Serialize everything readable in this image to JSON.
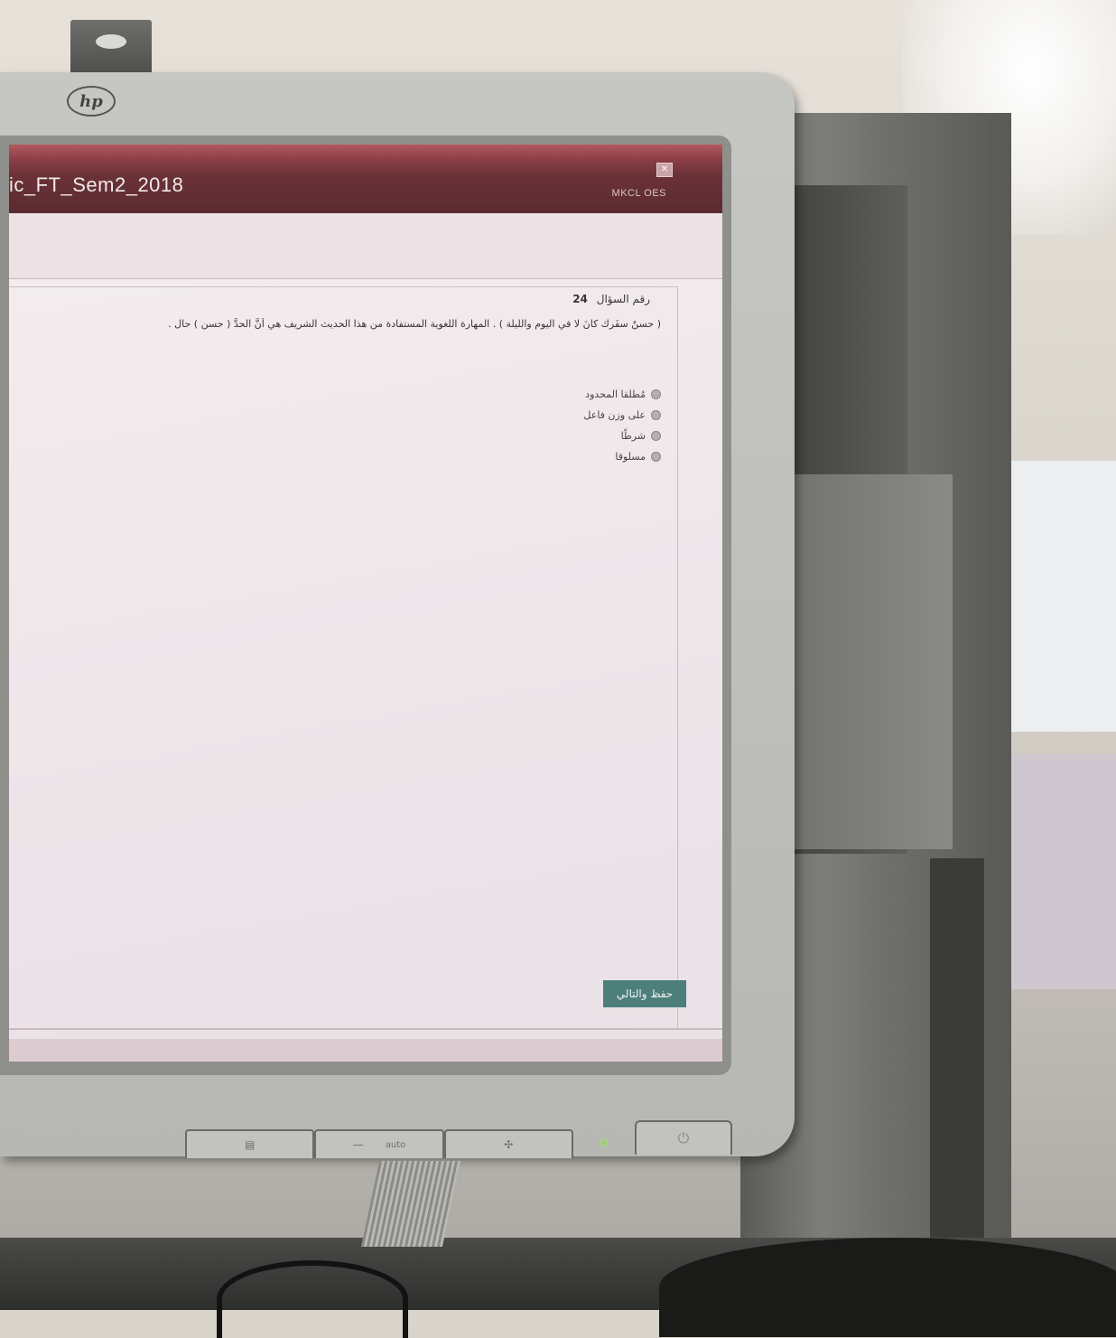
{
  "window": {
    "title": "ic_FT_Sem2_2018",
    "brand": "MKCL OES"
  },
  "question": {
    "number_label": "رقم السؤال",
    "number": "24",
    "text": "( حسنٌ سفَرك كانَ لا في اليوم والليلة ) . المهارة اللغوية المستفادة من هذا الحديث الشريف هي أنَّ الحدَّ ( حسن ) حال ."
  },
  "options": [
    {
      "label": "مُطلقا المحدود"
    },
    {
      "label": "على وزن فاعل"
    },
    {
      "label": "شرطًا"
    },
    {
      "label": "مسلوقا"
    }
  ],
  "actions": {
    "save_next_label": "حفظ والتالي"
  },
  "monitor": {
    "logo": "hp",
    "auto_label": "auto",
    "minus_label": "—",
    "menu_icon": "menu-icon",
    "input_icon": "input-icon",
    "power_icon": "power-icon"
  },
  "colors": {
    "titlebar": "#5a2b31",
    "button": "#4c7e7a",
    "screen_bg": "#efe7ea"
  }
}
